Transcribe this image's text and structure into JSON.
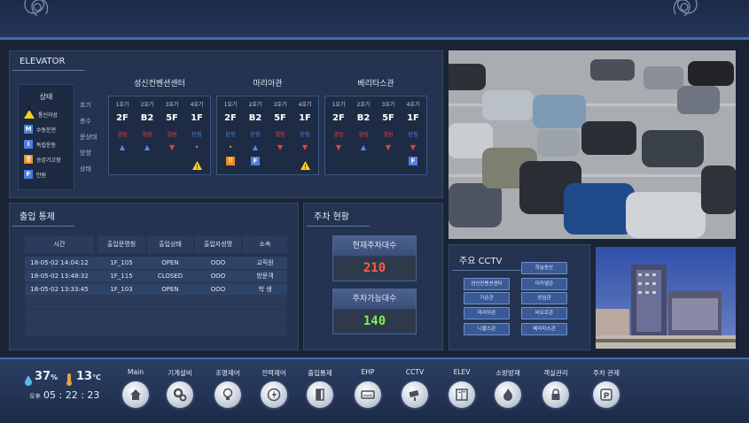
{
  "elevator": {
    "title": "ELEVATOR",
    "legend": {
      "title": "상태",
      "items": [
        {
          "icon": "!",
          "label": "통신이상",
          "icon_name": "warning-icon",
          "color": "#f5d020"
        },
        {
          "icon": "M",
          "label": "수동운전",
          "icon_name": "manual-icon",
          "color": "#4d7fe0"
        },
        {
          "icon": "I",
          "label": "독립운동",
          "icon_name": "independent-icon",
          "color": "#4d7fe0"
        },
        {
          "icon": "정",
          "label": "승강기고장",
          "icon_name": "fault-icon",
          "color": "#f08a20"
        },
        {
          "icon": "F",
          "label": "만원",
          "icon_name": "full-icon",
          "color": "#4d7fe0"
        }
      ]
    },
    "row_labels": [
      "호기",
      "층수",
      "문상태",
      "방향",
      "상태"
    ],
    "buildings": [
      {
        "name": "성신컨벤션센터",
        "cars": [
          {
            "car": "1호기",
            "floor": "2F",
            "door": "열림",
            "door_color": "red",
            "dir": "▲",
            "dir_color": "blue",
            "status": ""
          },
          {
            "car": "2호기",
            "floor": "B2",
            "door": "열림",
            "door_color": "red",
            "dir": "▲",
            "dir_color": "blue",
            "status": ""
          },
          {
            "car": "3호기",
            "floor": "5F",
            "door": "열림",
            "door_color": "red",
            "dir": "▼",
            "dir_color": "red",
            "status": ""
          },
          {
            "car": "4호기",
            "floor": "1F",
            "door": "닫힘",
            "door_color": "blue",
            "dir": "•",
            "dir_color": "dot",
            "status": "warning"
          }
        ]
      },
      {
        "name": "마리아관",
        "cars": [
          {
            "car": "1호기",
            "floor": "2F",
            "door": "닫힘",
            "door_color": "blue",
            "dir": "•",
            "dir_color": "dot",
            "status": "fault"
          },
          {
            "car": "2호기",
            "floor": "B2",
            "door": "닫힘",
            "door_color": "blue",
            "dir": "▲",
            "dir_color": "blue",
            "status": "full"
          },
          {
            "car": "3호기",
            "floor": "5F",
            "door": "열림",
            "door_color": "red",
            "dir": "▼",
            "dir_color": "red",
            "status": ""
          },
          {
            "car": "4호기",
            "floor": "1F",
            "door": "닫힘",
            "door_color": "blue",
            "dir": "▼",
            "dir_color": "red",
            "status": "warning"
          }
        ]
      },
      {
        "name": "베리타스관",
        "cars": [
          {
            "car": "1호기",
            "floor": "2F",
            "door": "열림",
            "door_color": "red",
            "dir": "▼",
            "dir_color": "red",
            "status": ""
          },
          {
            "car": "2호기",
            "floor": "B2",
            "door": "열림",
            "door_color": "red",
            "dir": "▲",
            "dir_color": "blue",
            "status": ""
          },
          {
            "car": "3호기",
            "floor": "5F",
            "door": "열림",
            "door_color": "red",
            "dir": "▼",
            "dir_color": "red",
            "status": ""
          },
          {
            "car": "4호기",
            "floor": "1F",
            "door": "닫힘",
            "door_color": "blue",
            "dir": "▼",
            "dir_color": "red",
            "status": "full"
          }
        ]
      }
    ]
  },
  "access": {
    "title": "출입 통제",
    "headers": [
      "시간",
      "출입문명칭",
      "출입상태",
      "출입자성명",
      "소속"
    ],
    "rows": [
      [
        "18-05-02 14:04:12",
        "1F_105",
        "OPEN",
        "OOO",
        "교직원"
      ],
      [
        "18-05-02 13:48:32",
        "1F_115",
        "CLOSED",
        "OOO",
        "방문객"
      ],
      [
        "18-05-02 13:33:45",
        "1F_103",
        "OPEN",
        "OOO",
        "학 생"
      ]
    ]
  },
  "parking": {
    "title": "주차 현황",
    "current_label": "현재주차대수",
    "current_value": "210",
    "available_label": "주차가능대수",
    "available_value": "140",
    "current_color": "#ff5a4a",
    "available_color": "#7cf050"
  },
  "cctv": {
    "title": "주요 CCTV",
    "buttons": [
      "하늘동산",
      "성신컨벤션센터",
      "미카엘관",
      "가순관",
      "성심관",
      "마리아관",
      "비오르관",
      "니콜스관",
      "베리타스관"
    ]
  },
  "status": {
    "humidity": "37",
    "humidity_unit": "%",
    "temp": "13",
    "temp_unit": "℃",
    "ampm": "오후",
    "time": "05 : 22 : 23"
  },
  "nav": [
    {
      "label": "Main",
      "icon": "home-icon"
    },
    {
      "label": "기계설비",
      "icon": "gears-icon"
    },
    {
      "label": "조명제어",
      "icon": "bulb-icon"
    },
    {
      "label": "전력제어",
      "icon": "power-icon"
    },
    {
      "label": "출입통제",
      "icon": "door-icon"
    },
    {
      "label": "EHP",
      "icon": "aircon-icon"
    },
    {
      "label": "CCTV",
      "icon": "camera-icon"
    },
    {
      "label": "ELEV",
      "icon": "elevator-icon"
    },
    {
      "label": "소방방재",
      "icon": "fire-icon"
    },
    {
      "label": "객실관리",
      "icon": "lock-icon"
    },
    {
      "label": "주차 관제",
      "icon": "parking-icon"
    }
  ]
}
